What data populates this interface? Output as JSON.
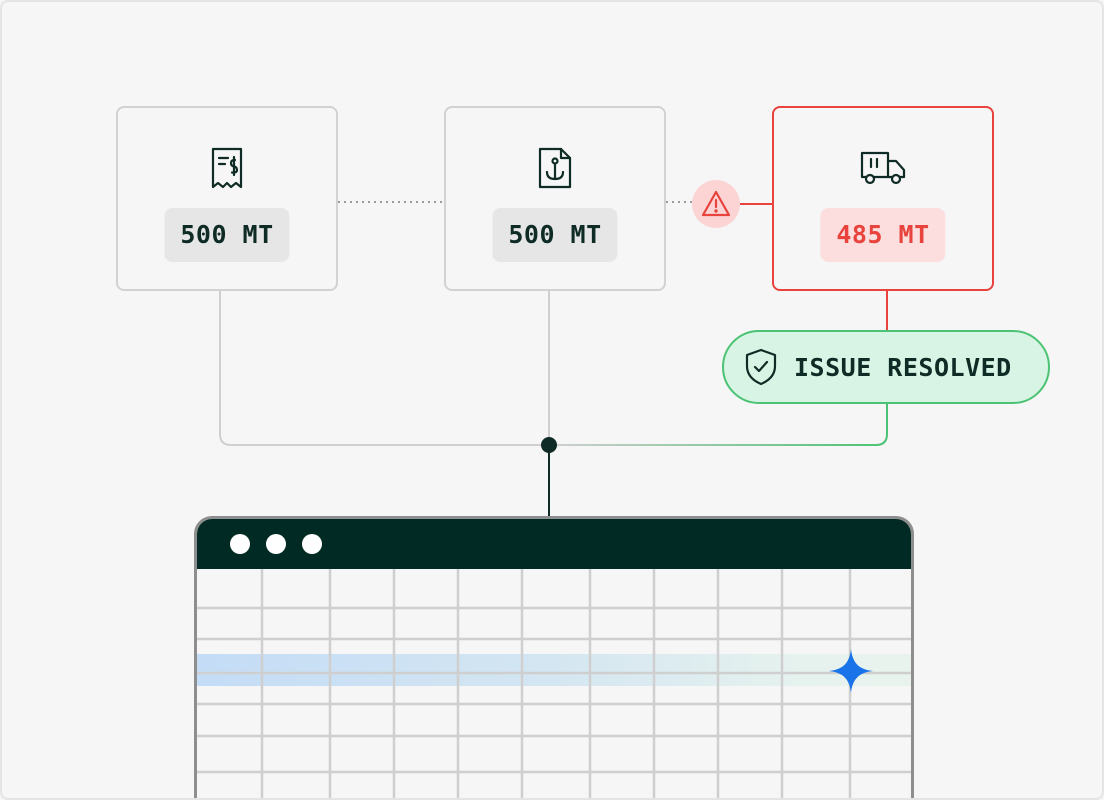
{
  "cards": [
    {
      "icon": "invoice-dollar-icon",
      "quantity": "500 MT",
      "status": "normal"
    },
    {
      "icon": "anchor-document-icon",
      "quantity": "500 MT",
      "status": "normal"
    },
    {
      "icon": "delivery-truck-icon",
      "quantity": "485 MT",
      "status": "discrepancy"
    }
  ],
  "warning": {
    "icon": "warning-triangle-icon"
  },
  "resolution": {
    "icon": "shield-check-icon",
    "label": "ISSUE RESOLVED"
  },
  "spreadsheet": {
    "window_controls": 3,
    "highlight_icon": "sparkle-icon"
  },
  "colors": {
    "ink": "#0f2b25",
    "alert": "#e8433c",
    "success": "#4cc374",
    "titlebar": "#002a23",
    "sparkle": "#1a73e8"
  }
}
